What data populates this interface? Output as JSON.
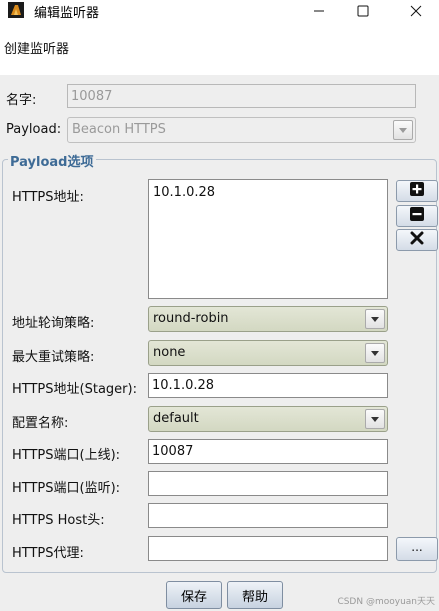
{
  "window": {
    "title": "编辑监听器"
  },
  "header": {
    "text": "创建监听器"
  },
  "fields": {
    "name_label": "名字:",
    "name_value": "10087",
    "payload_label": "Payload:",
    "payload_value": "Beacon HTTPS"
  },
  "options": {
    "group_title": "Payload选项",
    "https_hosts_label": "HTTPS地址:",
    "https_hosts": [
      "10.1.0.28"
    ],
    "rotation_label": "地址轮询策略:",
    "rotation_value": "round-robin",
    "max_retry_label": "最大重试策略:",
    "max_retry_value": "none",
    "stager_label": "HTTPS地址(Stager):",
    "stager_value": "10.1.0.28",
    "profile_label": "配置名称:",
    "profile_value": "default",
    "port_c2_label": "HTTPS端口(上线):",
    "port_c2_value": "10087",
    "port_bind_label": "HTTPS端口(监听):",
    "port_bind_value": "",
    "host_header_label": "HTTPS Host头:",
    "host_header_value": "",
    "proxy_label": "HTTPS代理:",
    "proxy_value": "",
    "proxy_button_label": "..."
  },
  "buttons": {
    "save_label": "保存",
    "help_label": "帮助"
  },
  "watermark": "CSDN @mooyuan天天"
}
